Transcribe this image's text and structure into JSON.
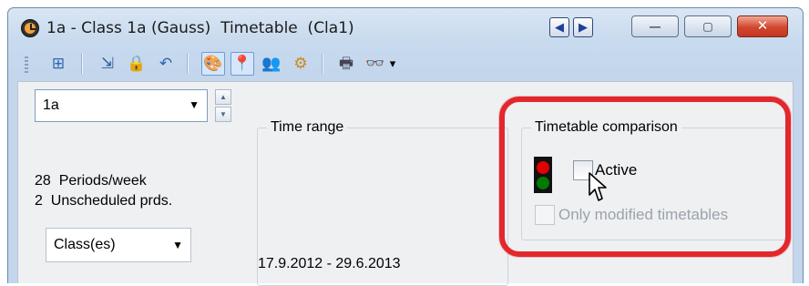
{
  "window": {
    "title": "1a - Class 1a (Gauss)  Timetable  (Cla1)",
    "icon": "clock-icon",
    "nav_prev_icon": "◀",
    "nav_next_icon": "▶",
    "minimize_symbol": "—",
    "maximize_symbol": "▢",
    "close_symbol": "✕"
  },
  "toolbar": {
    "buttons": [
      {
        "name": "grid-view-icon",
        "glyph": "⊞"
      },
      {
        "name": "import-icon",
        "glyph": "⇲"
      },
      {
        "name": "lock-icon",
        "glyph": "🔒"
      },
      {
        "name": "undo-icon",
        "glyph": "↶"
      },
      {
        "name": "palette-icon",
        "glyph": "🎨"
      },
      {
        "name": "pin-icon",
        "glyph": "📍"
      },
      {
        "name": "people-icon",
        "glyph": "👥"
      },
      {
        "name": "settings-icon",
        "glyph": "⚙"
      },
      {
        "name": "print-icon",
        "glyph": "🖶"
      },
      {
        "name": "binoculars-icon",
        "glyph": "👓"
      }
    ],
    "dropdown_glyph": "▾"
  },
  "left_panel": {
    "class_value": "1a",
    "periods_per_week": "28  Periods/week",
    "unscheduled": "2  Unscheduled prds.",
    "type_value": "Class(es)"
  },
  "time_range": {
    "label": "Time range",
    "dates": "17.9.2012 - 29.6.2013"
  },
  "comparison": {
    "label": "Timetable comparison",
    "active_label": "Active",
    "only_modified_label": "Only modified timetables",
    "traffic_light_colors": [
      "#e00000",
      "#007a00"
    ]
  },
  "colors": {
    "highlight": "#e2272d",
    "title_bar": "#c8daee",
    "close_button": "#d2452f"
  }
}
